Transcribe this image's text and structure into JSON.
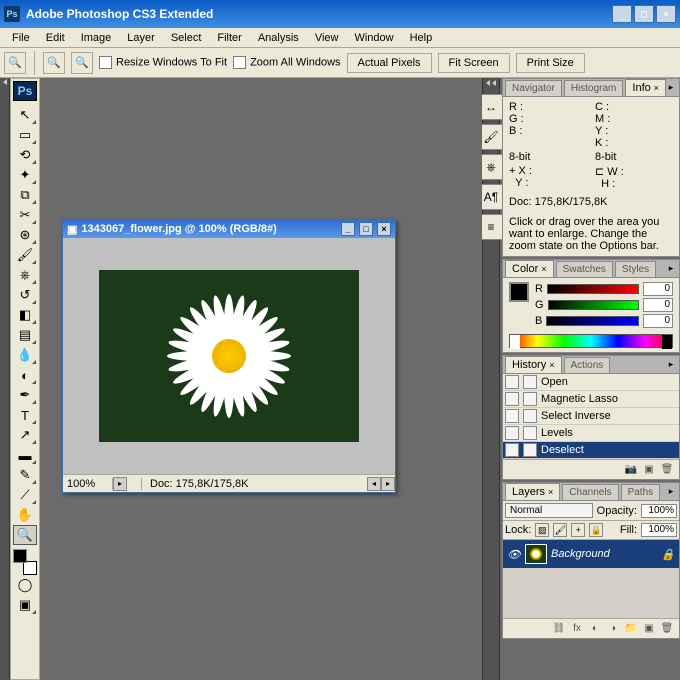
{
  "app": {
    "title": "Adobe Photoshop CS3 Extended",
    "menus": [
      "File",
      "Edit",
      "Image",
      "Layer",
      "Select",
      "Filter",
      "Analysis",
      "View",
      "Window",
      "Help"
    ]
  },
  "options": {
    "resize_label": "Resize Windows To Fit",
    "zoom_all_label": "Zoom All Windows",
    "btn_actual": "Actual Pixels",
    "btn_fit": "Fit Screen",
    "btn_print": "Print Size"
  },
  "document": {
    "title": "1343067_flower.jpg @ 100% (RGB/8#)",
    "zoom": "100%",
    "doc_info": "Doc: 175,8K/175,8K"
  },
  "info_panel": {
    "tabs": [
      "Navigator",
      "Histogram",
      "Info"
    ],
    "r": "R :",
    "g": "G :",
    "b": "B :",
    "c": "C :",
    "m": "M :",
    "y": "Y :",
    "k": "K :",
    "bit1": "8-bit",
    "bit2": "8-bit",
    "x": "X :",
    "yy": "Y :",
    "w": "W :",
    "h": "H :",
    "doc": "Doc: 175,8K/175,8K",
    "hint": "Click or drag over the area you want to enlarge. Change the zoom state on the Options bar."
  },
  "color_panel": {
    "tabs": [
      "Color",
      "Swatches",
      "Styles"
    ],
    "r_label": "R",
    "g_label": "G",
    "b_label": "B",
    "r_val": "0",
    "g_val": "0",
    "b_val": "0"
  },
  "history_panel": {
    "tabs": [
      "History",
      "Actions"
    ],
    "items": [
      {
        "label": "Open",
        "active": false
      },
      {
        "label": "Magnetic Lasso",
        "active": false
      },
      {
        "label": "Select Inverse",
        "active": false
      },
      {
        "label": "Levels",
        "active": false
      },
      {
        "label": "Deselect",
        "active": true
      }
    ]
  },
  "layers_panel": {
    "tabs": [
      "Layers",
      "Channels",
      "Paths"
    ],
    "blend_mode": "Normal",
    "opacity_label": "Opacity:",
    "opacity_val": "100%",
    "lock_label": "Lock:",
    "fill_label": "Fill:",
    "fill_val": "100%",
    "layer_name": "Background"
  }
}
